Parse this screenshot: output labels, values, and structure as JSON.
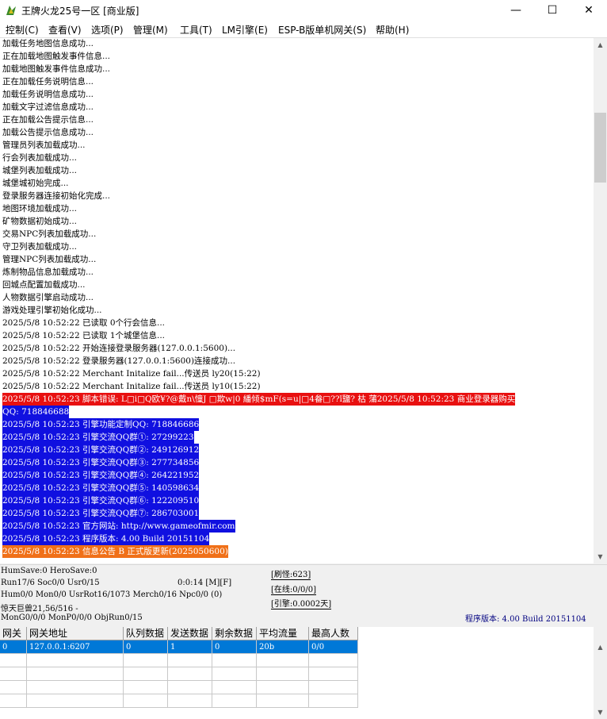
{
  "window": {
    "title": "王牌火龙25号一区 [商业版]",
    "minimize_glyph": "—",
    "maximize_glyph": "☐",
    "close_glyph": "✕"
  },
  "menu": [
    "控制(C)",
    "查看(V)",
    "选项(P)",
    "管理(M)",
    "工具(T)",
    "LM引擎(E)",
    "ESP-B版单机网关(S)",
    "帮助(H)"
  ],
  "log": [
    {
      "text": "加载任务地图信息成功..."
    },
    {
      "text": "正在加载地图触发事件信息..."
    },
    {
      "text": "加载地图触发事件信息成功..."
    },
    {
      "text": "正在加载任务说明信息..."
    },
    {
      "text": "加载任务说明信息成功..."
    },
    {
      "text": "加载文字过滤信息成功..."
    },
    {
      "text": "正在加载公告提示信息..."
    },
    {
      "text": "加载公告提示信息成功..."
    },
    {
      "text": "管理员列表加载成功..."
    },
    {
      "text": "行会列表加载成功..."
    },
    {
      "text": "城堡列表加载成功..."
    },
    {
      "text": "城堡城初始完成..."
    },
    {
      "text": "登录服务器连接初始化完成..."
    },
    {
      "text": "地图环境加载成功..."
    },
    {
      "text": "矿物数据初始成功..."
    },
    {
      "text": "交易NPC列表加载成功..."
    },
    {
      "text": "守卫列表加载成功..."
    },
    {
      "text": "管理NPC列表加载成功..."
    },
    {
      "text": "炼制物品信息加载成功..."
    },
    {
      "text": "回城点配置加载成功..."
    },
    {
      "text": "人物数据引擎启动成功..."
    },
    {
      "text": "游戏处理引擎初始化成功..."
    },
    {
      "text": "2025/5/8 10:52:22 已读取 0个行会信息..."
    },
    {
      "text": "2025/5/8 10:52:22 已读取 1个城堡信息..."
    },
    {
      "text": "2025/5/8 10:52:22 开始连接登录服务器(127.0.0.1:5600)..."
    },
    {
      "text": "2025/5/8 10:52:22 登录服务器(127.0.0.1:5600)连接成功..."
    },
    {
      "text": "2025/5/8 10:52:22 Merchant Initalize fail...传送员 ly20(15:22)"
    },
    {
      "text": "2025/5/8 10:52:22 Merchant Initalize fail...传送员 ly10(15:22)"
    },
    {
      "text": "2025/5/8 10:52:23 脚本错误: L□i□Q欧¥?@戴n\\憧J  □欺w|0  繙倾$mF(s=u|□4畚□??ǐ鹽?  枯 蒲2025/5/8 10:52:23 商业登录器购买",
      "hl": "red"
    },
    {
      "text": "QQ: 718846688",
      "hl": "blue"
    },
    {
      "text": "2025/5/8 10:52:23 引擎功能定制QQ: 718846686",
      "hl": "blue"
    },
    {
      "text": "2025/5/8 10:52:23 引擎交流QQ群①: 27299223",
      "hl": "blue"
    },
    {
      "text": "2025/5/8 10:52:23 引擎交流QQ群②: 249126912",
      "hl": "blue"
    },
    {
      "text": "2025/5/8 10:52:23 引擎交流QQ群③: 277734856",
      "hl": "blue"
    },
    {
      "text": "2025/5/8 10:52:23 引擎交流QQ群④: 264221952",
      "hl": "blue"
    },
    {
      "text": "2025/5/8 10:52:23 引擎交流QQ群⑤: 140598634",
      "hl": "blue"
    },
    {
      "text": "2025/5/8 10:52:23 引擎交流QQ群⑥: 122209510",
      "hl": "blue"
    },
    {
      "text": "2025/5/8 10:52:23 引擎交流QQ群⑦: 286703001",
      "hl": "blue"
    },
    {
      "text": "2025/5/8 10:52:23 官方网站: http://www.gameofmir.com",
      "hl": "blue"
    },
    {
      "text": "2025/5/8 10:52:23 程序版本: 4.00 Build 20151104",
      "hl": "blue"
    },
    {
      "text": "2025/5/8 10:52:23 信息公告 B 正式版更新(2025050600)",
      "hl": "orange"
    }
  ],
  "status": {
    "line1": "HumSave:0 HeroSave:0",
    "line2": "Run17/6 Soc0/0 Usr0/15",
    "time": "0:0:14 [M][F]",
    "line3": "Hum0/0 Mon0/0 UsrRot16/1073 Merch0/16 Npc0/0 (0)",
    "line4": "惊天巨兽21,56/516 -",
    "line5": "MonG0/0/0 MonP0/0/0 ObjRun0/15",
    "refresh": "[刷怪:623]",
    "online": "[在线:0/0/0]",
    "engine": "[引擎:0.0002天]",
    "version": "程序版本: 4.00 Build 20151104"
  },
  "gateway_table": {
    "columns": [
      "网关",
      "网关地址",
      "队列数据",
      "发送数据",
      "剩余数据",
      "平均流量",
      "最高人数"
    ],
    "rows": [
      [
        "0",
        "127.0.0.1:6207",
        "0",
        "1",
        "0",
        "20b",
        "0/0"
      ]
    ]
  },
  "colors": {
    "error_bg": "#e81010",
    "info_bg": "#1010e0",
    "notice_bg": "#f07018",
    "selection_bg": "#0078d7"
  }
}
